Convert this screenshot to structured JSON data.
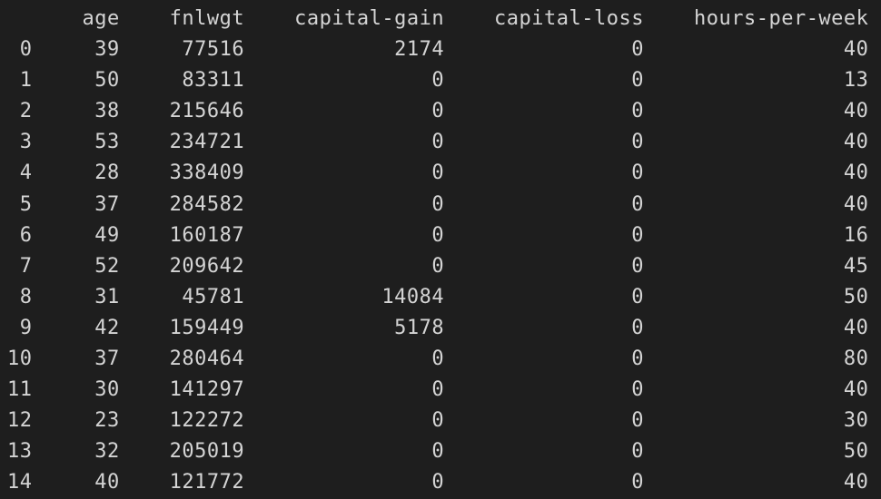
{
  "chart_data": {
    "type": "table",
    "columns": [
      "age",
      "fnlwgt",
      "capital-gain",
      "capital-loss",
      "hours-per-week"
    ],
    "index": [
      0,
      1,
      2,
      3,
      4,
      5,
      6,
      7,
      8,
      9,
      10,
      11,
      12,
      13,
      14
    ],
    "rows": [
      {
        "age": 39,
        "fnlwgt": 77516,
        "capital-gain": 2174,
        "capital-loss": 0,
        "hours-per-week": 40
      },
      {
        "age": 50,
        "fnlwgt": 83311,
        "capital-gain": 0,
        "capital-loss": 0,
        "hours-per-week": 13
      },
      {
        "age": 38,
        "fnlwgt": 215646,
        "capital-gain": 0,
        "capital-loss": 0,
        "hours-per-week": 40
      },
      {
        "age": 53,
        "fnlwgt": 234721,
        "capital-gain": 0,
        "capital-loss": 0,
        "hours-per-week": 40
      },
      {
        "age": 28,
        "fnlwgt": 338409,
        "capital-gain": 0,
        "capital-loss": 0,
        "hours-per-week": 40
      },
      {
        "age": 37,
        "fnlwgt": 284582,
        "capital-gain": 0,
        "capital-loss": 0,
        "hours-per-week": 40
      },
      {
        "age": 49,
        "fnlwgt": 160187,
        "capital-gain": 0,
        "capital-loss": 0,
        "hours-per-week": 16
      },
      {
        "age": 52,
        "fnlwgt": 209642,
        "capital-gain": 0,
        "capital-loss": 0,
        "hours-per-week": 45
      },
      {
        "age": 31,
        "fnlwgt": 45781,
        "capital-gain": 14084,
        "capital-loss": 0,
        "hours-per-week": 50
      },
      {
        "age": 42,
        "fnlwgt": 159449,
        "capital-gain": 5178,
        "capital-loss": 0,
        "hours-per-week": 40
      },
      {
        "age": 37,
        "fnlwgt": 280464,
        "capital-gain": 0,
        "capital-loss": 0,
        "hours-per-week": 80
      },
      {
        "age": 30,
        "fnlwgt": 141297,
        "capital-gain": 0,
        "capital-loss": 0,
        "hours-per-week": 40
      },
      {
        "age": 23,
        "fnlwgt": 122272,
        "capital-gain": 0,
        "capital-loss": 0,
        "hours-per-week": 30
      },
      {
        "age": 32,
        "fnlwgt": 205019,
        "capital-gain": 0,
        "capital-loss": 0,
        "hours-per-week": 50
      },
      {
        "age": 40,
        "fnlwgt": 121772,
        "capital-gain": 0,
        "capital-loss": 0,
        "hours-per-week": 40
      }
    ]
  },
  "col_widths": {
    "index": 2,
    "age": 5,
    "fnlwgt": 8,
    "capital-gain": 14,
    "capital-loss": 14,
    "hours-per-week": 16
  }
}
